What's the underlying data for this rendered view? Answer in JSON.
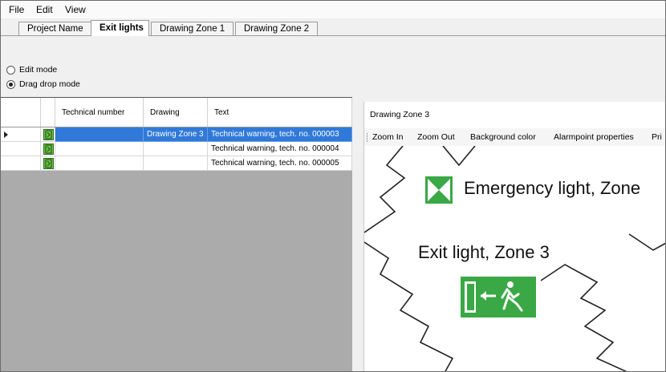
{
  "menu": [
    "File",
    "Edit",
    "View"
  ],
  "tabs": [
    "Project Name",
    "Exit lights",
    "Drawing Zone 1",
    "Drawing Zone 2"
  ],
  "modes": {
    "edit_label": "Edit mode",
    "drag_label": "Drag drop mode",
    "selected": "Drag drop mode"
  },
  "grid": {
    "headers": {
      "technical_number": "Technical number",
      "drawing": "Drawing",
      "text": "Text"
    },
    "rows": [
      {
        "drawing": "Drawing Zone 3",
        "text": "Technical warning, tech. no. 000003",
        "selected": true
      },
      {
        "drawing": "",
        "text": "Technical warning, tech. no. 000004",
        "selected": false
      },
      {
        "drawing": "",
        "text": "Technical warning, tech. no. 000005",
        "selected": false
      }
    ]
  },
  "drawing_panel": {
    "title": "Drawing Zone 3",
    "toolbar": [
      "Zoom In",
      "Zoom Out",
      "Background color",
      "Alarmpoint properties",
      "Pri"
    ],
    "labels": {
      "emergency": "Emergency light, Zone",
      "exit": "Exit light, Zone 3"
    }
  },
  "colors": {
    "selection": "#3079d9",
    "sign_green": "#39a845",
    "grid_background": "#ababab"
  },
  "icons": {
    "row": "exit-sign-icon",
    "emergency": "emergency-light-icon",
    "exit": "exit-light-icon"
  }
}
